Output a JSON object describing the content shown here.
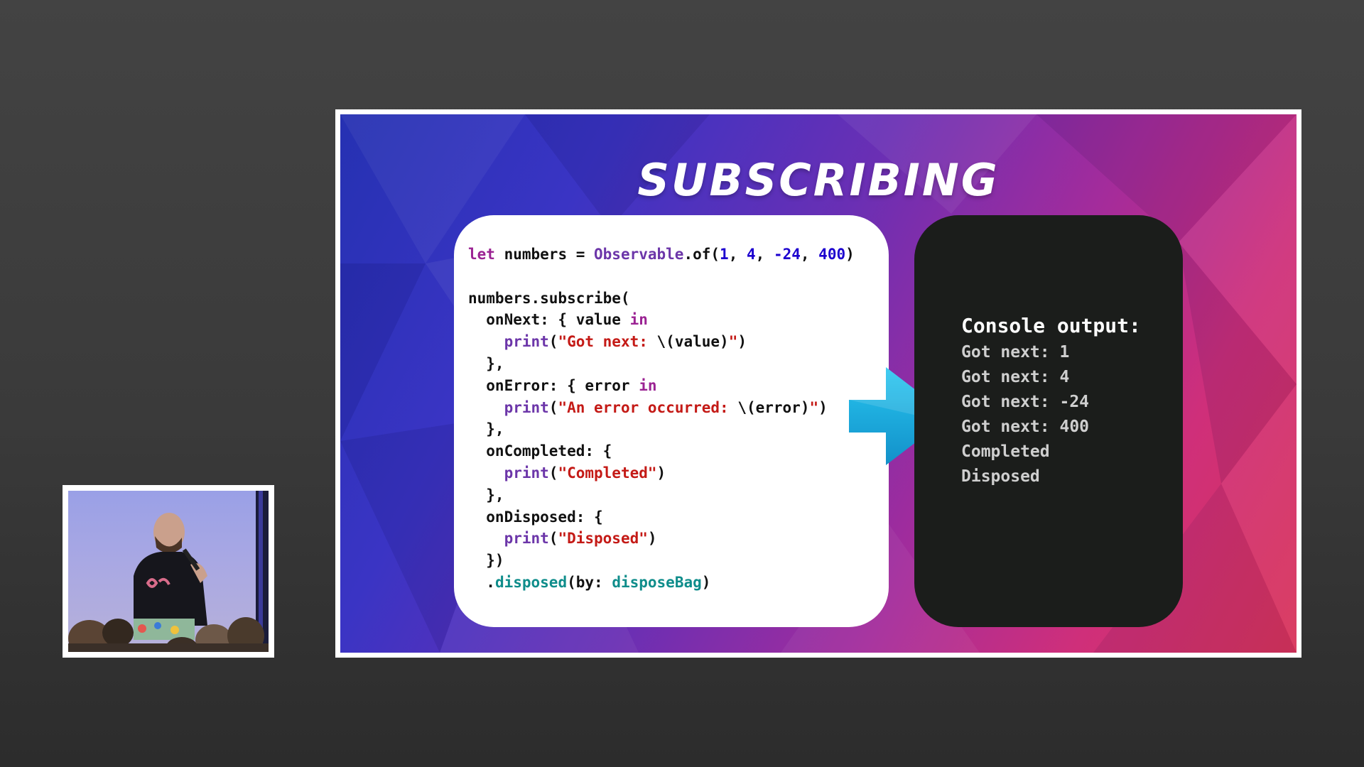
{
  "slide": {
    "title": "SUBSCRIBING",
    "code_lines": [
      [
        {
          "t": "let",
          "c": "kw"
        },
        {
          "t": " numbers = "
        },
        {
          "t": "Observable",
          "c": "fn"
        },
        {
          "t": ".of("
        },
        {
          "t": "1",
          "c": "num"
        },
        {
          "t": ", "
        },
        {
          "t": "4",
          "c": "num"
        },
        {
          "t": ", "
        },
        {
          "t": "-24",
          "c": "num"
        },
        {
          "t": ", "
        },
        {
          "t": "400",
          "c": "num"
        },
        {
          "t": ")"
        }
      ],
      [],
      [
        {
          "t": "numbers.subscribe("
        }
      ],
      [
        {
          "t": "  onNext: { value "
        },
        {
          "t": "in",
          "c": "kw"
        }
      ],
      [
        {
          "t": "    "
        },
        {
          "t": "print",
          "c": "fn"
        },
        {
          "t": "("
        },
        {
          "t": "\"Got next: ",
          "c": "str"
        },
        {
          "t": "\\(value)"
        },
        {
          "t": "\"",
          "c": "str"
        },
        {
          "t": ")"
        }
      ],
      [
        {
          "t": "  },"
        }
      ],
      [
        {
          "t": "  onError: { error "
        },
        {
          "t": "in",
          "c": "kw"
        }
      ],
      [
        {
          "t": "    "
        },
        {
          "t": "print",
          "c": "fn"
        },
        {
          "t": "("
        },
        {
          "t": "\"An error occurred: ",
          "c": "str"
        },
        {
          "t": "\\(error)"
        },
        {
          "t": "\"",
          "c": "str"
        },
        {
          "t": ")"
        }
      ],
      [
        {
          "t": "  },"
        }
      ],
      [
        {
          "t": "  onCompleted: {"
        }
      ],
      [
        {
          "t": "    "
        },
        {
          "t": "print",
          "c": "fn"
        },
        {
          "t": "("
        },
        {
          "t": "\"Completed\"",
          "c": "str"
        },
        {
          "t": ")"
        }
      ],
      [
        {
          "t": "  },"
        }
      ],
      [
        {
          "t": "  onDisposed: {"
        }
      ],
      [
        {
          "t": "    "
        },
        {
          "t": "print",
          "c": "fn"
        },
        {
          "t": "("
        },
        {
          "t": "\"Disposed\"",
          "c": "str"
        },
        {
          "t": ")"
        }
      ],
      [
        {
          "t": "  })"
        }
      ],
      [
        {
          "t": "  ."
        },
        {
          "t": "disposed",
          "c": "tl"
        },
        {
          "t": "(by: "
        },
        {
          "t": "disposeBag",
          "c": "tl"
        },
        {
          "t": ")"
        }
      ]
    ],
    "console": {
      "heading": "Console output:",
      "lines": [
        "Got next: 1",
        "Got next: 4",
        "Got next: -24",
        "Got next: 400",
        "Completed",
        "Disposed"
      ]
    },
    "colors": {
      "keyword": "#9b2393",
      "function": "#6c36a9",
      "number": "#1c00cf",
      "string": "#c41a16",
      "teal": "#0f8d8b",
      "arrow": "#19a9dc"
    },
    "arrow_icon": "right-arrow-icon"
  },
  "speaker_cam": {
    "description_icon": "speaker-video-feed"
  }
}
